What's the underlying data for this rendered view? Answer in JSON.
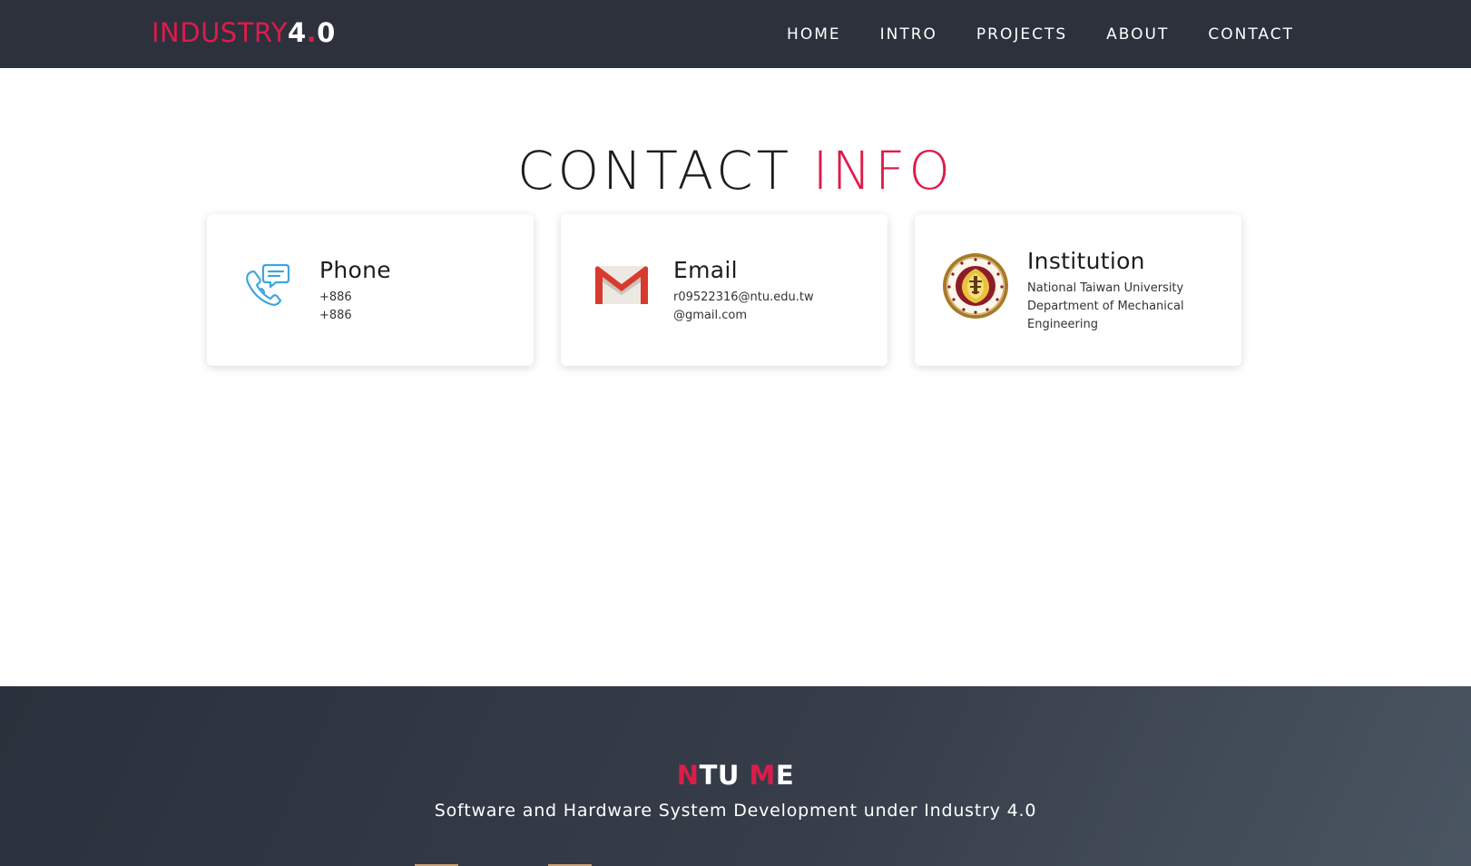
{
  "navbar": {
    "brand": {
      "part1": "INDUSTRY",
      "part2": "4",
      "part3": ".",
      "part4": "0"
    },
    "links": [
      {
        "label": "HOME"
      },
      {
        "label": "INTRO"
      },
      {
        "label": "PROJECTS"
      },
      {
        "label": "ABOUT"
      },
      {
        "label": "CONTACT"
      }
    ]
  },
  "contact": {
    "title_part1": "CONTACT ",
    "title_part2": "INFO",
    "cards": {
      "phone": {
        "heading": "Phone",
        "lines": [
          "+886",
          "+886"
        ],
        "icon": "phone-chat-icon"
      },
      "email": {
        "heading": "Email",
        "lines": [
          "r09522316@ntu.edu.tw",
          "@gmail.com"
        ],
        "icon": "gmail-icon"
      },
      "institution": {
        "heading": "Institution",
        "lines": [
          "National Taiwan University",
          "Department of Mechanical",
          "Engineering"
        ],
        "icon": "university-seal-icon"
      }
    }
  },
  "footer": {
    "title": {
      "n": "N",
      "tu": "TU ",
      "m": "M",
      "e": "E"
    },
    "subtitle": "Software and Hardware System Development under Industry 4.0"
  },
  "colors": {
    "navbar_bg": "#2c313c",
    "accent": "#dd1c4a",
    "text_dark": "#1d1d1d",
    "phone_icon": "#3ea5e0",
    "gmail_red": "#d93a2e",
    "seal_gold": "#a87a27"
  }
}
